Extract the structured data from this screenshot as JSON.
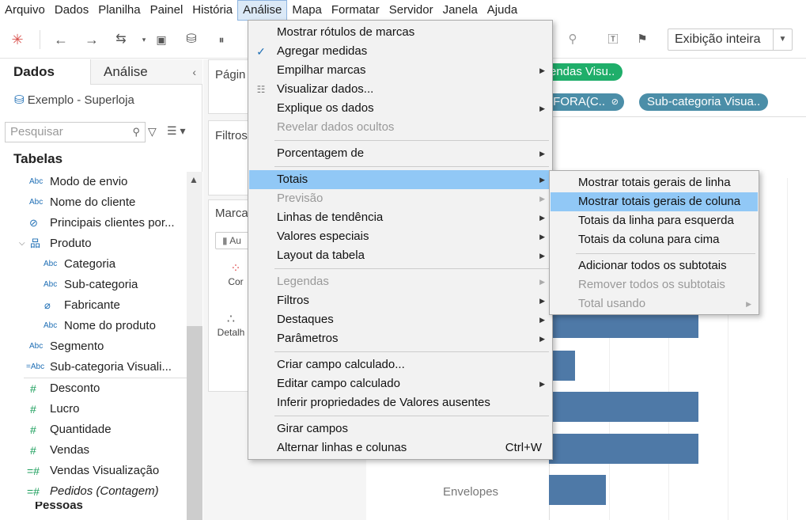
{
  "menubar": [
    "Arquivo",
    "Dados",
    "Planilha",
    "Painel",
    "História",
    "Análise",
    "Mapa",
    "Formatar",
    "Servidor",
    "Janela",
    "Ajuda"
  ],
  "toolbar": {
    "view_mode": "Exibição inteira",
    "icons": [
      "tableau-logo-icon",
      "back-icon",
      "forward-icon",
      "swap-icon",
      "save-icon",
      "new-datasource-icon",
      "pause-icon",
      "text-icon",
      "pin-icon",
      "attach-icon"
    ]
  },
  "datapane": {
    "tab_data": "Dados",
    "tab_analysis": "Análise",
    "datasource": "Exemplo - Superloja",
    "search_placeholder": "Pesquisar",
    "tables_header": "Tabelas",
    "dimensions": [
      {
        "type": "Abc",
        "name": "Modo de envio"
      },
      {
        "type": "Abc",
        "name": "Nome do cliente"
      },
      {
        "type": "link",
        "name": "Principais clientes por..."
      },
      {
        "type": "hierarchy",
        "name": "Produto"
      },
      {
        "type": "Abc",
        "name": "Categoria"
      },
      {
        "type": "Abc",
        "name": "Sub-categoria"
      },
      {
        "type": "link",
        "name": "Fabricante"
      },
      {
        "type": "Abc",
        "name": "Nome do produto"
      },
      {
        "type": "Abc",
        "name": "Segmento"
      },
      {
        "type": "=Abc",
        "name": "Sub-categoria Visuali..."
      }
    ],
    "measures": [
      {
        "type": "#",
        "name": "Desconto"
      },
      {
        "type": "#",
        "name": "Lucro"
      },
      {
        "type": "#",
        "name": "Quantidade"
      },
      {
        "type": "#",
        "name": "Vendas"
      },
      {
        "type": "=#",
        "name": "Vendas Visualização"
      },
      {
        "type": "=#",
        "name": "Pedidos (Contagem)"
      }
    ],
    "truncated_bottom": "Pessoas"
  },
  "shelves": {
    "pages": "Págin",
    "filters": "Filtros",
    "marks": "Marca",
    "marks_type": "Au",
    "color": "Cor",
    "detail": "Detalh"
  },
  "viz": {
    "pill_row1": "endas Visu..",
    "pill_row2a": "/FORA(C..",
    "pill_row2b": "Sub-categoria Visua..",
    "row_label": "Envelopes",
    "bar_values": [
      0.58,
      0.58,
      0.58,
      0.58,
      0.1,
      0.58,
      0.58,
      0.22
    ]
  },
  "analysis_menu": {
    "items": [
      {
        "label": "Mostrar rótulos de marcas"
      },
      {
        "label": "Agregar medidas",
        "checked": true
      },
      {
        "label": "Empilhar marcas",
        "sub": true
      },
      {
        "label": "Visualizar dados...",
        "icon": "table-icon"
      },
      {
        "label": "Explique os dados",
        "sub": true
      },
      {
        "label": "Revelar dados ocultos",
        "disabled": true
      },
      {
        "label": "Porcentagem de",
        "sub": true
      },
      {
        "label": "Totais",
        "sub": true,
        "highlighted": true
      },
      {
        "label": "Previsão",
        "sub": true,
        "disabled": true
      },
      {
        "label": "Linhas de tendência",
        "sub": true
      },
      {
        "label": "Valores especiais",
        "sub": true
      },
      {
        "label": "Layout da tabela",
        "sub": true
      },
      {
        "label": "Legendas",
        "sub": true,
        "disabled": true
      },
      {
        "label": "Filtros",
        "sub": true
      },
      {
        "label": "Destaques",
        "sub": true
      },
      {
        "label": "Parâmetros",
        "sub": true
      },
      {
        "label": "Criar campo calculado..."
      },
      {
        "label": "Editar campo calculado",
        "sub": true
      },
      {
        "label": "Inferir propriedades de Valores ausentes"
      },
      {
        "label": "Girar campos"
      },
      {
        "label": "Alternar linhas e colunas",
        "shortcut": "Ctrl+W"
      }
    ]
  },
  "totals_submenu": {
    "items": [
      {
        "label": "Mostrar totais gerais de linha"
      },
      {
        "label": "Mostrar totais gerais de coluna",
        "highlighted": true
      },
      {
        "label": "Totais da linha para esquerda"
      },
      {
        "label": "Totais da coluna para cima"
      },
      {
        "label": "Adicionar todos os subtotais"
      },
      {
        "label": "Remover todos os subtotais",
        "disabled": true
      },
      {
        "label": "Total usando",
        "sub": true,
        "disabled": true
      }
    ]
  },
  "colors": {
    "accent": "#91c8f6",
    "bar": "#4e79a7",
    "pill_green": "#1fae6a",
    "pill_teal": "#4b8ea8"
  }
}
